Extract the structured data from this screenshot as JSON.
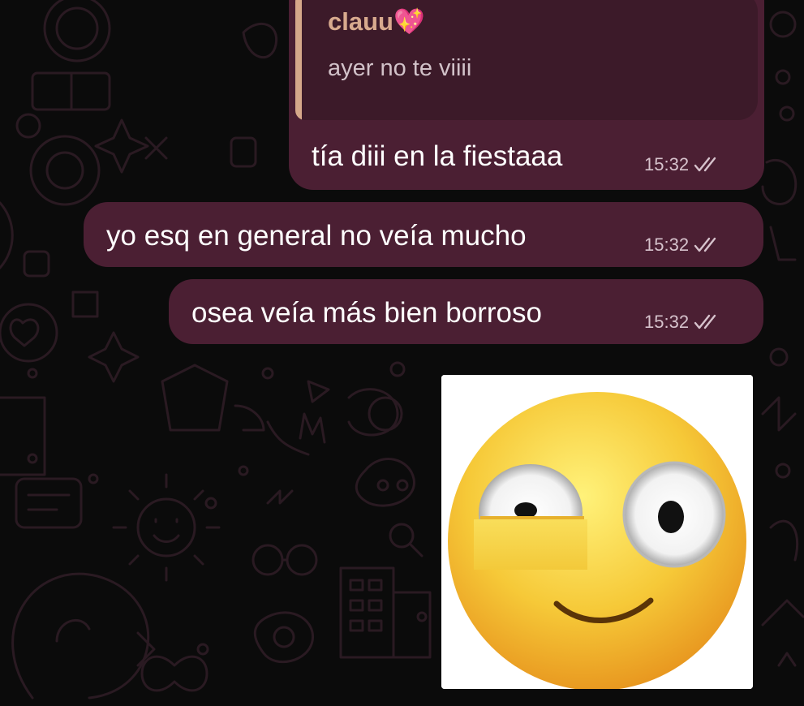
{
  "chat": {
    "reply_card": {
      "author": "clauu",
      "author_emoji": "💖",
      "quoted_text": "ayer no te viiii",
      "text": "tía diii en la fiestaaa",
      "time": "15:32",
      "status_icon": "double-check-icon"
    },
    "messages": [
      {
        "text": "yo esq en general no veía mucho",
        "time": "15:32",
        "status_icon": "double-check-icon"
      },
      {
        "text": "osea veía más bien borroso",
        "time": "15:32",
        "status_icon": "double-check-icon"
      }
    ],
    "sticker": {
      "icon": "flushed-uneven-eyes-emoji-sticker"
    }
  },
  "colors": {
    "background": "#0b0b0b",
    "wallpaper_doodles": "#2a1a22",
    "bubble": "#4b1f33",
    "quote_background": "#3c1a29",
    "quote_bar": "#d6a88a",
    "author": "#d8aa8e"
  }
}
